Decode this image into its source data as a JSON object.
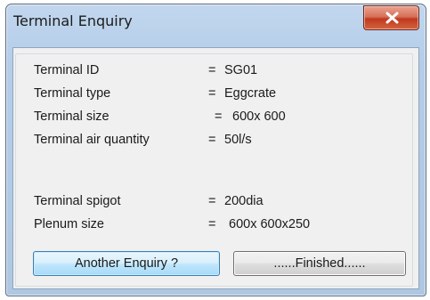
{
  "window": {
    "title": "Terminal Enquiry"
  },
  "fields": [
    {
      "label": "Terminal ID",
      "eq": "=",
      "value": "SG01"
    },
    {
      "label": "Terminal type",
      "eq": "=",
      "value": "Eggcrate"
    },
    {
      "label": "Terminal size",
      "eq": "=",
      "value": "600x 600"
    },
    {
      "label": "Terminal air quantity",
      "eq": "=",
      "value": "50l/s"
    },
    {
      "label": "Terminal spigot",
      "eq": "=",
      "value": "200dia"
    },
    {
      "label": "Plenum size",
      "eq": "=",
      "value": "600x 600x250"
    }
  ],
  "buttons": {
    "another": "Another Enquiry ?",
    "finished": "......Finished......"
  },
  "icons": {
    "close": "close-icon"
  },
  "colors": {
    "close_button": "#c8462b",
    "title_bar": "#b9d1ea",
    "client_bg": "#f0f0f0"
  }
}
